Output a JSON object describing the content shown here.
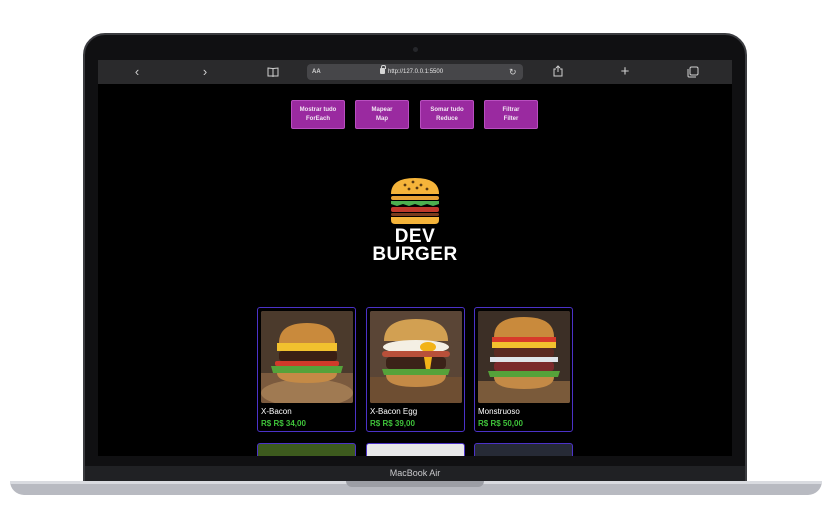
{
  "browser": {
    "text_size_label": "AA",
    "url": "http://127.0.0.1:5500",
    "icons": [
      "back-icon",
      "forward-icon",
      "bookmarks-icon",
      "lock-icon",
      "reload-icon",
      "share-icon",
      "new-tab-icon",
      "tabs-icon"
    ]
  },
  "toolbar": {
    "buttons": [
      {
        "label": "Mostrar tudo\nForEach"
      },
      {
        "label": "Mapear\nMap"
      },
      {
        "label": "Somar tudo\nReduce"
      },
      {
        "label": "Filtrar\nFilter"
      }
    ]
  },
  "logo": {
    "text": "DEV\nBURGER"
  },
  "products": [
    {
      "name": "X-Bacon",
      "price": "R$ R$ 34,00"
    },
    {
      "name": "X-Bacon Egg",
      "price": "R$ R$ 39,00"
    },
    {
      "name": "Monstruoso",
      "price": "R$ R$ 50,00"
    }
  ],
  "device": {
    "label": "MacBook Air"
  },
  "colors": {
    "button": "#9a2aa0",
    "price": "#3fc23a",
    "card_border": "#4b32c8",
    "background": "#000000"
  }
}
